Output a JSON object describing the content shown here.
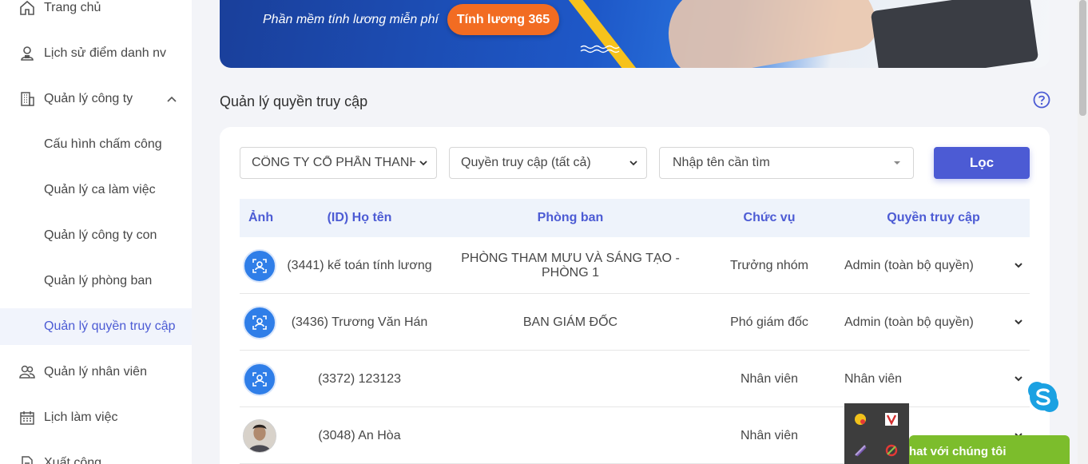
{
  "sidebar": {
    "items": [
      {
        "label": "Trang chủ",
        "icon": "home-icon"
      },
      {
        "label": "Lịch sử điểm danh nv",
        "icon": "user-history-icon"
      },
      {
        "label": "Quản lý công ty",
        "icon": "building-icon"
      },
      {
        "label": "Cấu hình chấm công"
      },
      {
        "label": "Quản lý ca làm việc"
      },
      {
        "label": "Quản lý công ty con"
      },
      {
        "label": "Quản lý phòng ban"
      },
      {
        "label": "Quản lý quyền truy cập",
        "active": true
      },
      {
        "label": "Quản lý nhân viên",
        "icon": "users-icon"
      },
      {
        "label": "Lịch làm việc",
        "icon": "calendar-icon"
      },
      {
        "label": "Xuất công",
        "icon": "document-icon"
      }
    ]
  },
  "banner": {
    "slogan": "Phần mềm tính lương miễn phí",
    "cta_label": "Tính lương 365"
  },
  "page": {
    "title": "Quản lý quyền truy cập"
  },
  "filters": {
    "company": "CÔNG TY CỔ PHẦN THANH THIÊN",
    "access": "Quyền truy cập (tất cả)",
    "search_placeholder": "Nhập tên cần tìm",
    "submit_label": "Lọc"
  },
  "table": {
    "headers": [
      "Ảnh",
      "(ID) Họ tên",
      "Phòng ban",
      "Chức vụ",
      "Quyền truy cập"
    ],
    "rows": [
      {
        "name": "(3441) kế toán tính lương",
        "department": "PHÒNG THAM MƯU VÀ SÁNG TẠO - PHÒNG 1",
        "position": "Trưởng nhóm",
        "access": "Admin (toàn bộ quyền)",
        "avatar": "default"
      },
      {
        "name": "(3436) Trương Văn Hán",
        "department": "BAN GIÁM ĐỐC",
        "position": "Phó giám đốc",
        "access": "Admin (toàn bộ quyền)",
        "avatar": "default"
      },
      {
        "name": "(3372) 123123",
        "department": "",
        "position": "Nhân viên",
        "access": "Nhân viên",
        "avatar": "default"
      },
      {
        "name": "(3048) An Hòa",
        "department": "",
        "position": "Nhân viên",
        "access": "",
        "avatar": "photo"
      }
    ]
  },
  "chat": {
    "label": "hat với chúng tôi"
  },
  "colors": {
    "accent": "#4c5bd4",
    "cta": "#f26c22",
    "chat": "#7cbd2c"
  }
}
